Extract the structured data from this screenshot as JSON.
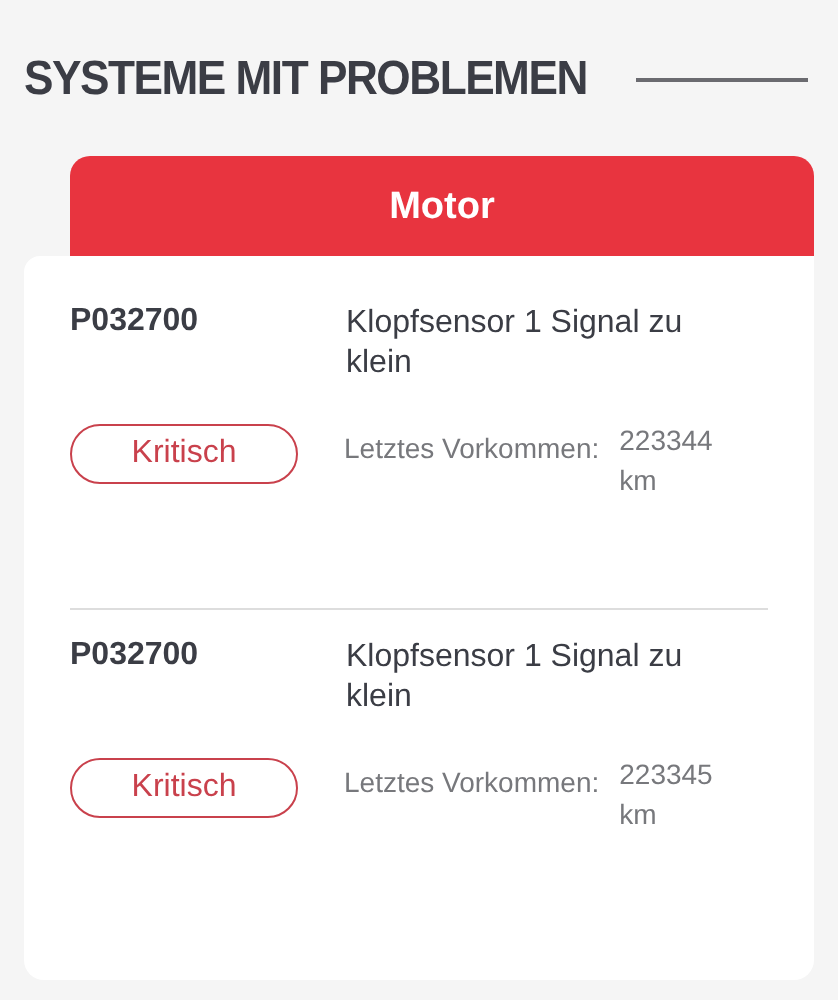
{
  "heading": "SYSTEME MIT PROBLEMEN",
  "system": {
    "title": "Motor"
  },
  "faults": [
    {
      "code": "P032700",
      "description": "Klopfsensor 1 Signal zu klein",
      "badge": "Kritisch",
      "occurrence_label": "Letztes Vorkommen:",
      "mileage": "223344 km"
    },
    {
      "code": "P032700",
      "description": "Klopfsensor 1 Signal zu klein",
      "badge": "Kritisch",
      "occurrence_label": "Letztes Vorkommen:",
      "mileage": "223345 km"
    }
  ]
}
